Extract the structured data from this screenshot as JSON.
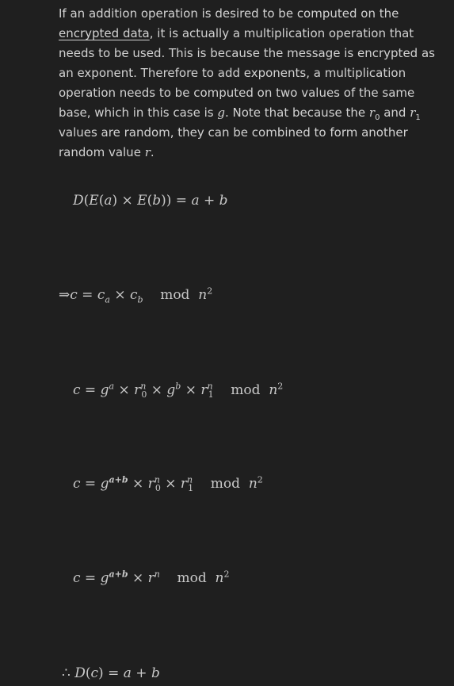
{
  "paragraph": {
    "text_1": "If an addition operation is desired to be computed on the ",
    "link_text": "encrypted data",
    "text_2": ", it is actually a multiplication operation that needs to be used. This is because the message is encrypted as an exponent. Therefore to add exponents, a multiplication operation needs to be computed on two values of the same base, which in this case is ",
    "var_g": "g",
    "text_3": ". Note that because the ",
    "var_r0": "r",
    "sub_0": "0",
    "text_4": " and ",
    "var_r1": "r",
    "sub_1": "1",
    "text_5": " values are random, they can be combined to form another random value ",
    "var_r": "r",
    "text_6": "."
  },
  "equations": {
    "eq1": "D(E(a) × E(b)) = a + b",
    "eq2": "⇒c = c_a × c_b   mod n²",
    "eq3": "c = gᵃ × r₀ⁿ × gᵇ × r₁ⁿ   mod n²",
    "eq4": "c = gᵃ⁺ᵇ × r₀ⁿ × r₁ⁿ   mod n²",
    "eq5": "c = gᵃ⁺ᵇ × rⁿ   mod n²",
    "eq6": "∴ D(c) = a + b"
  }
}
